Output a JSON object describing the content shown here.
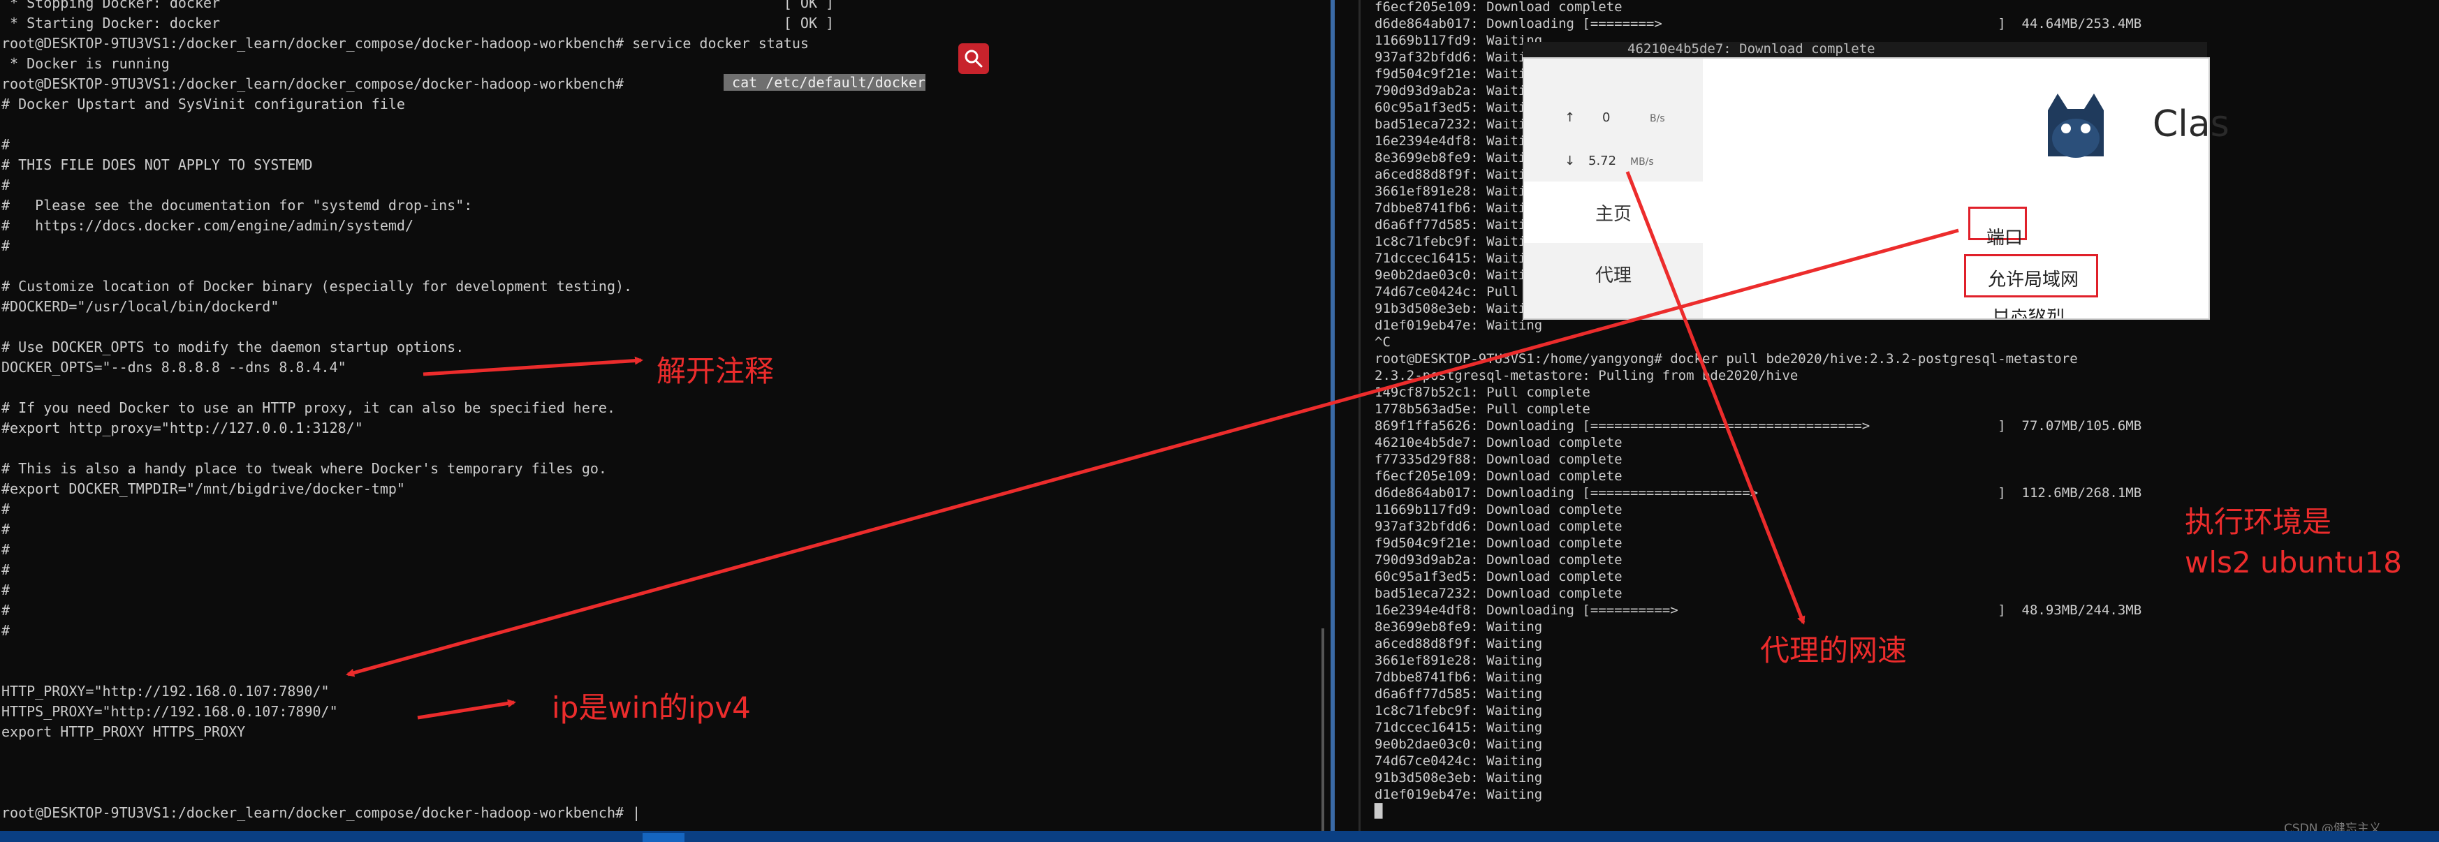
{
  "left_terminal": {
    "lines": [
      " * Stopping Docker: docker                                                                   [ OK ]",
      " * Starting Docker: docker                                                                   [ OK ]",
      "root@DESKTOP-9TU3VS1:/docker_learn/docker_compose/docker-hadoop-workbench# service docker status",
      " * Docker is running",
      "root@DESKTOP-9TU3VS1:/docker_learn/docker_compose/docker-hadoop-workbench#",
      "# Docker Upstart and SysVinit configuration file",
      "",
      "#",
      "# THIS FILE DOES NOT APPLY TO SYSTEMD",
      "#",
      "#   Please see the documentation for \"systemd drop-ins\":",
      "#   https://docs.docker.com/engine/admin/systemd/",
      "#",
      "",
      "# Customize location of Docker binary (especially for development testing).",
      "#DOCKERD=\"/usr/local/bin/dockerd\"",
      "",
      "# Use DOCKER_OPTS to modify the daemon startup options.",
      "DOCKER_OPTS=\"--dns 8.8.8.8 --dns 8.8.4.4\"",
      "",
      "# If you need Docker to use an HTTP proxy, it can also be specified here.",
      "#export http_proxy=\"http://127.0.0.1:3128/\"",
      "",
      "# This is also a handy place to tweak where Docker's temporary files go.",
      "#export DOCKER_TMPDIR=\"/mnt/bigdrive/docker-tmp\"",
      "#",
      "#",
      "#",
      "#",
      "#",
      "#",
      "#",
      "",
      "",
      "HTTP_PROXY=\"http://192.168.0.107:7890/\"",
      "HTTPS_PROXY=\"http://192.168.0.107:7890/\"",
      "export HTTP_PROXY HTTPS_PROXY",
      "",
      "",
      "",
      "root@DESKTOP-9TU3VS1:/docker_learn/docker_compose/docker-hadoop-workbench# |"
    ],
    "highlighted_command": " cat /etc/default/docker"
  },
  "right_terminal": {
    "lines": [
      "f6ecf205e109: Download complete",
      "d6de864ab017: Downloading [========>                                          ]  44.64MB/253.4MB",
      "11669b117fd9: Waiting",
      "937af32bfdd6: Waiting",
      "f9d504c9f21e: Waiting",
      "790d93d9ab2a: Waiting",
      "60c95a1f3ed5: Waiting",
      "bad51eca7232: Waiting",
      "16e2394e4df8: Waiting",
      "8e3699eb8fe9: Waiting",
      "a6ced88d8f9f: Waiting",
      "3661ef891e28: Waiting",
      "7dbbe8741fb6: Waiting",
      "d6a6ff77d585: Waiting",
      "1c8c71febc9f: Waiting",
      "71dccec16415: Waiting",
      "9e0b2dae03c0: Waiting",
      "74d67ce0424c: Pull complete",
      "91b3d508e3eb: Waiting",
      "d1ef019eb47e: Waiting",
      "^C",
      "root@DESKTOP-9TU3VS1:/home/yangyong# docker pull bde2020/hive:2.3.2-postgresql-metastore",
      "2.3.2-postgresql-metastore: Pulling from bde2020/hive",
      "149cf87b52c1: Pull complete",
      "1778b563ad5e: Pull complete",
      "869f1ffa5626: Downloading [==================================>                ]  77.07MB/105.6MB",
      "46210e4b5de7: Download complete",
      "f77335d29f88: Download complete",
      "f6ecf205e109: Download complete",
      "d6de864ab017: Downloading [====================>                              ]  112.6MB/268.1MB",
      "11669b117fd9: Download complete",
      "937af32bfdd6: Download complete",
      "f9d504c9f21e: Download complete",
      "790d93d9ab2a: Download complete",
      "60c95a1f3ed5: Download complete",
      "bad51eca7232: Download complete",
      "16e2394e4df8: Downloading [==========>                                        ]  48.93MB/244.3MB",
      "8e3699eb8fe9: Waiting",
      "a6ced88d8f9f: Waiting",
      "3661ef891e28: Waiting",
      "7dbbe8741fb6: Waiting",
      "d6a6ff77d585: Waiting",
      "1c8c71febc9f: Waiting",
      "71dccec16415: Waiting",
      "9e0b2dae03c0: Waiting",
      "74d67ce0424c: Waiting",
      "91b3d508e3eb: Waiting",
      "d1ef019eb47e: Waiting",
      "█"
    ],
    "behind_overlay_lines": [
      "46210e4b5de7: Download complete"
    ]
  },
  "proxy_app": {
    "upload_speed": "0",
    "upload_unit": "B/s",
    "download_speed": "5.72",
    "download_unit": "MB/s",
    "nav_home": "主页",
    "nav_proxy": "代理",
    "port_label": "端口",
    "allow_lan_label": "允许局域网",
    "log_level_label": "日志级别",
    "brand": "Clas"
  },
  "annotations": {
    "uncomment": "解开注释",
    "ip_note": "ip是win的ipv4",
    "proxy_speed": "代理的网速",
    "env_line1": "执行环境是",
    "env_line2": "wls2 ubuntu18"
  },
  "watermark": "CSDN @健忘主义",
  "colors": {
    "annotation_red": "#ec2c2c",
    "terminal_text": "#cccccc",
    "terminal_bg": "#0c0c0c"
  }
}
